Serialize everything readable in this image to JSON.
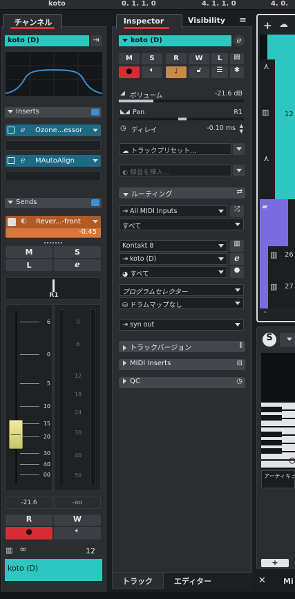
{
  "topbar": {
    "track_name": "koto",
    "pos1": "0. 1. 1.   0",
    "pos2": "4. 1. 1.   0",
    "pos3": "4. 0."
  },
  "channel": {
    "tab_label": "チャンネル",
    "track_name": "koto (D)",
    "inserts_label": "Inserts",
    "inserts": [
      {
        "name": "Ozone...essor"
      },
      {
        "name": "MAutoAlign"
      }
    ],
    "sends_label": "Sends",
    "send": {
      "name": "Rever...-front",
      "value": "-0.45"
    },
    "m_label": "M",
    "s_label": "S",
    "l_label": "L",
    "pan_value": "R1",
    "fader_scale": [
      "6",
      "0",
      "5",
      "10",
      "15",
      "20",
      "30",
      "40",
      "00"
    ],
    "meter_scale": [
      "0",
      "6",
      "12",
      "18",
      "24",
      "30",
      "40",
      "50"
    ],
    "volume_db": "-21.6",
    "peak_db": "-oo",
    "r_label": "R",
    "w_label": "W",
    "midi_channel": "12",
    "footer_name": "koto (D)",
    "fader_level": 0.24
  },
  "inspector": {
    "tab_inspector": "Inspector",
    "tab_visibility": "Visibility",
    "track_name": "koto (D)",
    "buttons_row1": [
      "M",
      "S",
      "R",
      "W",
      "L"
    ],
    "volume_label": "ボリューム",
    "volume_value": "-21.6 dB",
    "pan_label": "Pan",
    "pan_value": "R1",
    "delay_label": "ディレイ",
    "delay_value": "-0.10 ms",
    "track_preset": "トラックプリセット...",
    "insert_sound": "録音を挿入...",
    "routing_label": "ルーティング",
    "input": "All MIDI Inputs",
    "input_channel": "すべて",
    "instrument": "Kontakt 8",
    "output": "koto (D)",
    "output_channel": "すべて",
    "program_selector": "プログラムセレクター",
    "drum_map": "ドラムマップなし",
    "sync": "syn out",
    "track_versions": "トラックバージョン",
    "midi_inserts": "MIDI Inserts",
    "qc": "QC",
    "bottom_tab1": "トラック",
    "bottom_tab2": "エディター"
  },
  "right": {
    "track_numbers": [
      "12",
      "26",
      "27"
    ],
    "bottom_dash": "-",
    "articulation": "アーティキュレ",
    "mix": "Mi"
  },
  "colors": {
    "cyan": "#2ec6c0",
    "purple": "#7b6be0",
    "red": "#e0323a",
    "accent_blue": "#3f8fd0"
  }
}
